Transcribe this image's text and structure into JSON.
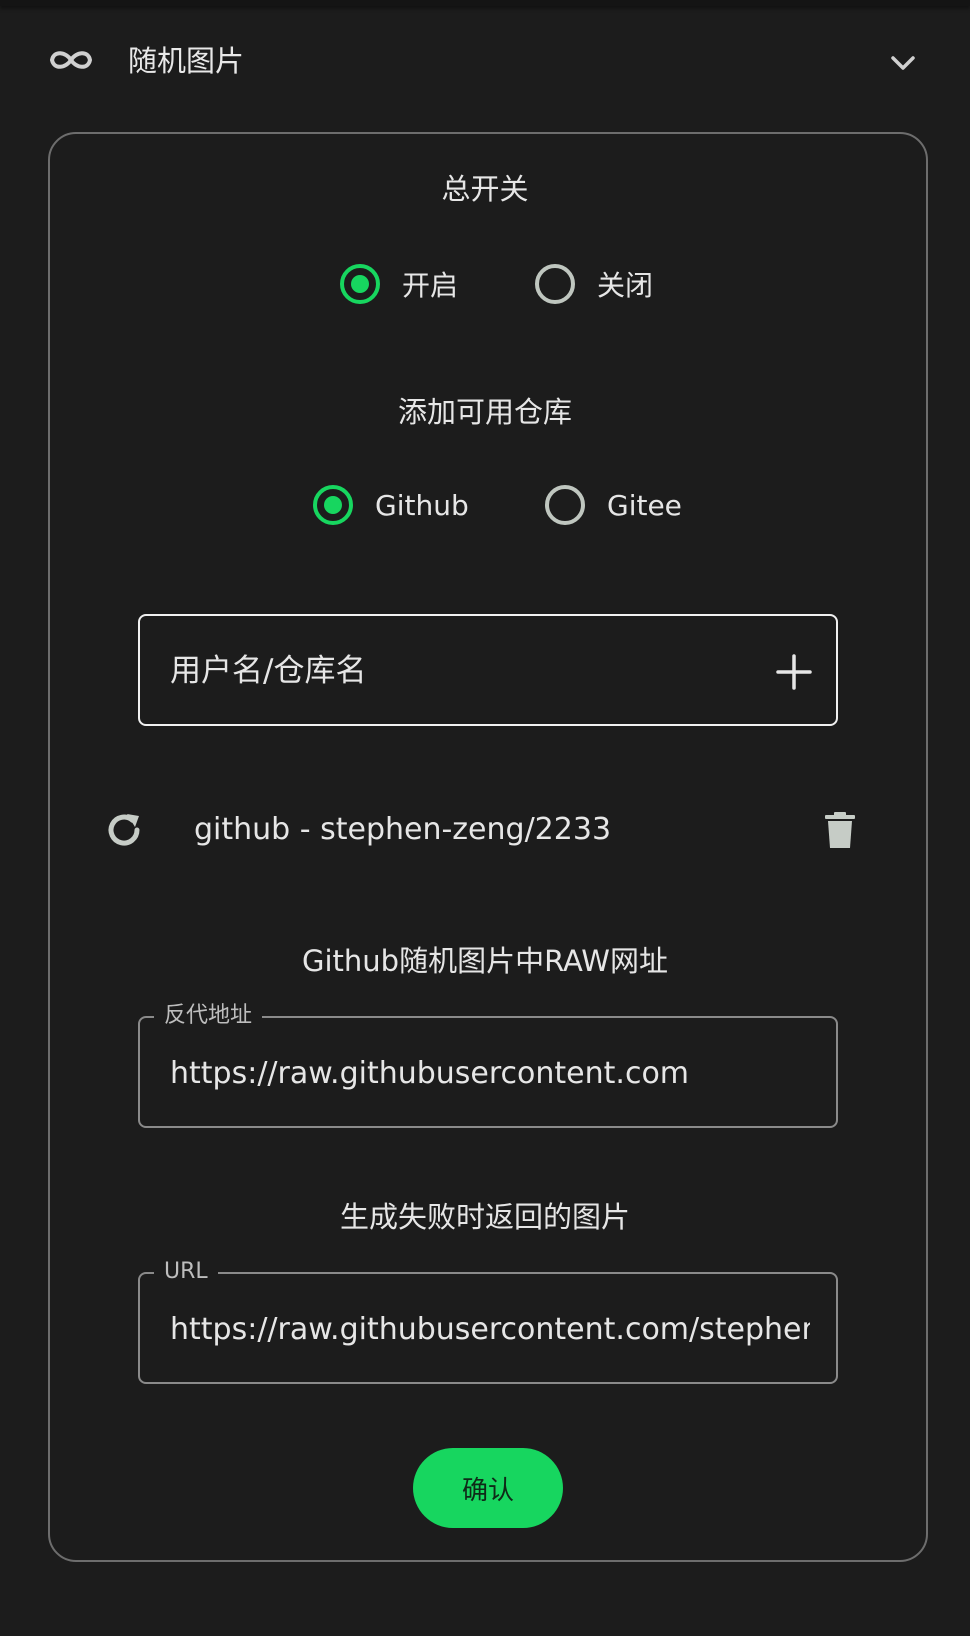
{
  "header": {
    "title": "随机图片"
  },
  "master_switch": {
    "title": "总开关",
    "options": [
      {
        "label": "开启",
        "selected": true
      },
      {
        "label": "关闭",
        "selected": false
      }
    ]
  },
  "add_repo": {
    "title": "添加可用仓库",
    "options": [
      {
        "label": "Github",
        "selected": true
      },
      {
        "label": "Gitee",
        "selected": false
      }
    ],
    "input_placeholder": "用户名/仓库名"
  },
  "repos": [
    {
      "label": "github - stephen-zeng/2233"
    }
  ],
  "raw_url": {
    "title": "Github随机图片中RAW网址",
    "legend": "反代地址",
    "value": "https://raw.githubusercontent.com"
  },
  "fallback": {
    "title": "生成失败时返回的图片",
    "legend": "URL",
    "value": "https://raw.githubusercontent.com/stephen"
  },
  "confirm_label": "确认",
  "colors": {
    "accent": "#17d65f",
    "background": "#1c1c1c",
    "radio_off": "#bfc6bf"
  },
  "icons": [
    "infinity-icon",
    "chevron-down-icon",
    "plus-icon",
    "refresh-icon",
    "trash-icon"
  ]
}
